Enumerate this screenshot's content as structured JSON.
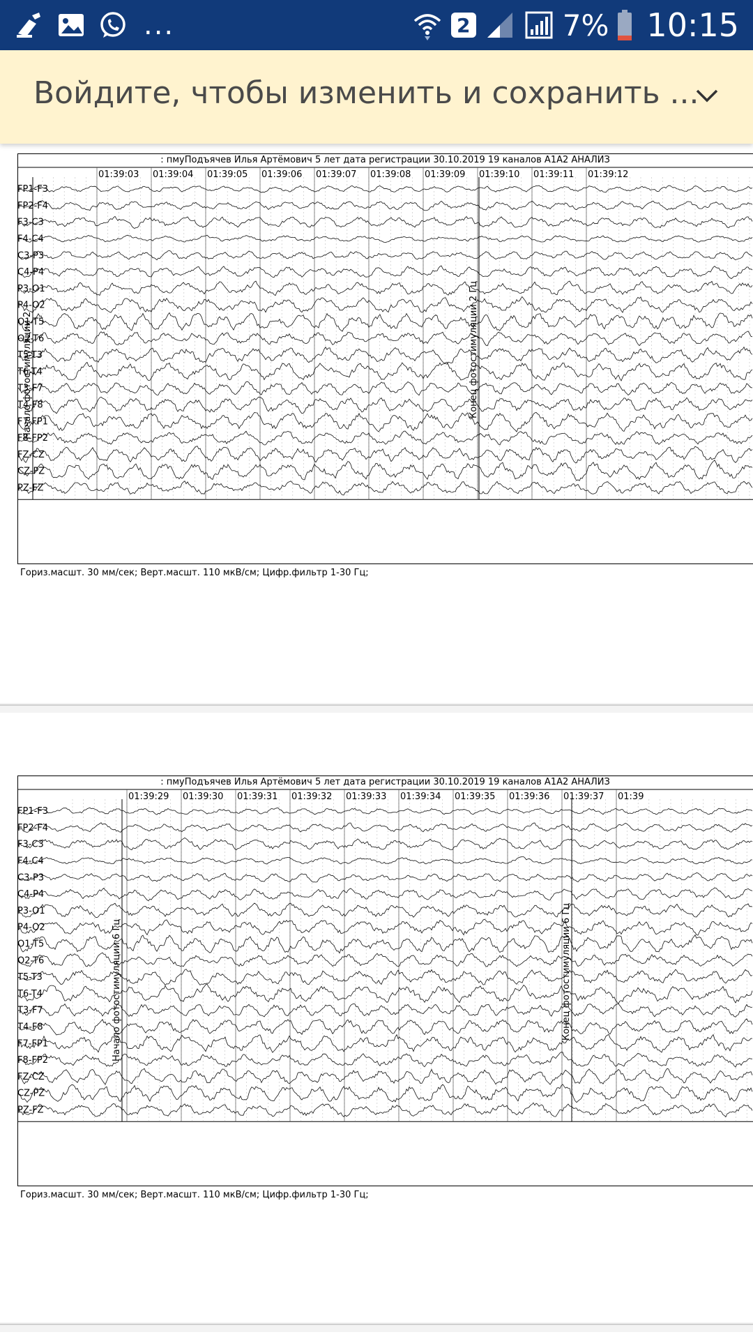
{
  "status_bar": {
    "left_icons": [
      "cleaner-icon",
      "gallery-icon",
      "whatsapp-icon"
    ],
    "overflow": "...",
    "sim_badge": "2",
    "battery_pct": "7%",
    "time": "10:15"
  },
  "banner": {
    "text": "Войдите, чтобы изменить и сохранить ...",
    "chevron_icon": "chevron-down-icon"
  },
  "pages": [
    {
      "header": ": пмуПодъячев Илья Артёмович 5 лет дата регистрации 30.10.2019 19 каналов A1A2 АНАЛИЗ",
      "footer": "Гориз.масшт. 30 мм/сек; Верт.масшт. 110 мкВ/см; Цифр.фильтр 1-30 Гц;",
      "times": [
        "01:39:03",
        "01:39:04",
        "01:39:05",
        "01:39:06",
        "01:39:07",
        "01:39:08",
        "01:39:09",
        "01:39:10",
        "01:39:11",
        "01:39:12"
      ],
      "channels": [
        "FP1-F3",
        "FP2-F4",
        "F3-C3",
        "F4-C4",
        "C3-P3",
        "C4-P4",
        "P3-O1",
        "P4-O2",
        "O1-T5",
        "O2-T6",
        "T5-T3",
        "T6-T4",
        "T3-F7",
        "T4-F8",
        "F7-FP1",
        "F8-FP2",
        "FZ-CZ",
        "CZ-PZ",
        "PZ-FZ"
      ],
      "markers": [
        "Начало фотостимуляции 2",
        "Конец фотостимуляции 2 Гц"
      ]
    },
    {
      "header": ": пмуПодъячев Илья Артёмович 5 лет дата регистрации 30.10.2019 19 каналов A1A2 АНАЛИЗ",
      "footer": "Гориз.масшт. 30 мм/сек; Верт.масшт. 110 мкВ/см; Цифр.фильтр 1-30 Гц;",
      "times": [
        "01:39:29",
        "01:39:30",
        "01:39:31",
        "01:39:32",
        "01:39:33",
        "01:39:34",
        "01:39:35",
        "01:39:36",
        "01:39:37",
        "01:39"
      ],
      "channels": [
        "FP1-F3",
        "FP2-F4",
        "F3-C3",
        "F4-C4",
        "C3-P3",
        "C4-P4",
        "P3-O1",
        "P4-O2",
        "O1-T5",
        "O2-T6",
        "T5-T3",
        "T6-T4",
        "T3-F7",
        "T4-F8",
        "F7-FP1",
        "F8-FP2",
        "FZ-CZ",
        "CZ-PZ",
        "PZ-FZ"
      ],
      "markers": [
        "Начало фотостимуляции 6 Гц",
        "Конец фотостимуляции 6 Гц"
      ]
    }
  ]
}
